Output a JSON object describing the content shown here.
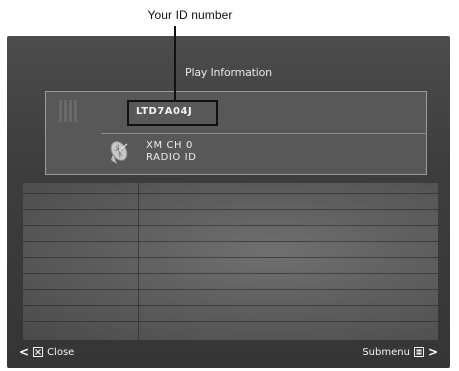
{
  "annotation": {
    "callout_label": "Your ID number"
  },
  "screen": {
    "title": "Play Information",
    "radio_id": "LTD7A04J",
    "channel": "XM CH 0",
    "radio_id_label": "RADIO ID"
  },
  "footer": {
    "close_label": "Close",
    "submenu_label": "Submenu"
  },
  "icons": {
    "left_chevron": "chevron-left-icon",
    "close_button": "close-button-icon",
    "submenu_button": "submenu-button-icon",
    "right_chevron": "chevron-right-icon",
    "signal": "signal-strength-icon",
    "satellite": "satellite-dish-icon"
  },
  "colors": {
    "screen_bg": "#3d3d3d",
    "panel_bg": "#585858",
    "highlight_border": "#111111",
    "text": "#f0f0f0"
  }
}
